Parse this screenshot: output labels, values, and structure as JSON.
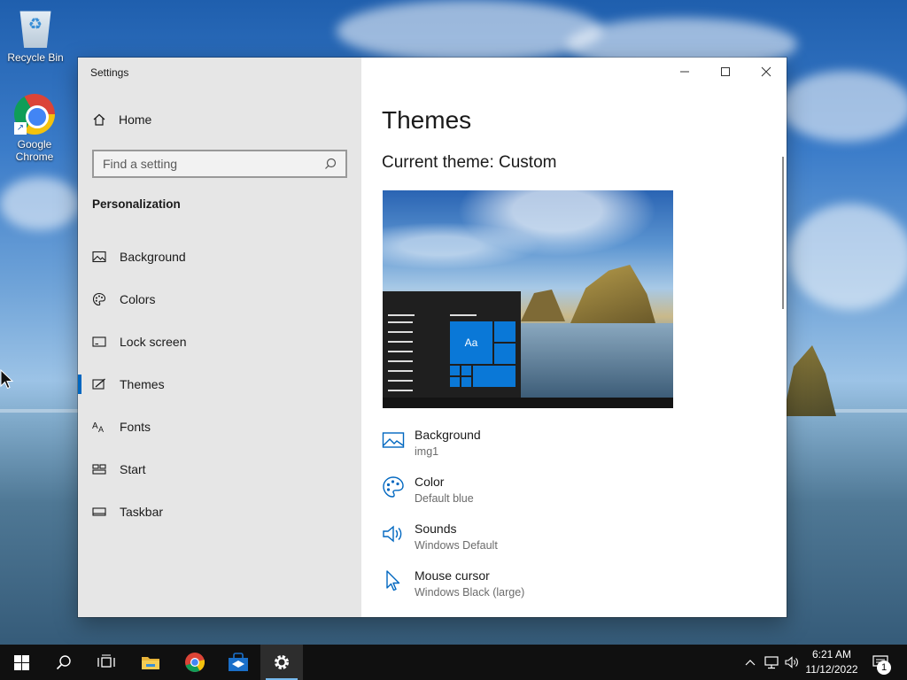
{
  "desktop": {
    "icons": [
      {
        "label": "Recycle Bin",
        "icon": "recycle-bin-icon"
      },
      {
        "label": "Google Chrome",
        "icon": "chrome-icon"
      }
    ]
  },
  "window": {
    "title": "Settings",
    "caption": {
      "minimize": "minimize-icon",
      "maximize": "maximize-icon",
      "close": "close-icon"
    }
  },
  "sidebar": {
    "home_label": "Home",
    "search_placeholder": "Find a setting",
    "section_title": "Personalization",
    "items": [
      {
        "label": "Background",
        "icon": "picture-icon",
        "active": false
      },
      {
        "label": "Colors",
        "icon": "palette-icon",
        "active": false
      },
      {
        "label": "Lock screen",
        "icon": "lock-screen-icon",
        "active": false
      },
      {
        "label": "Themes",
        "icon": "themes-icon",
        "active": true
      },
      {
        "label": "Fonts",
        "icon": "fonts-icon",
        "active": false
      },
      {
        "label": "Start",
        "icon": "start-icon",
        "active": false
      },
      {
        "label": "Taskbar",
        "icon": "taskbar-icon",
        "active": false
      }
    ]
  },
  "main": {
    "title": "Themes",
    "current_theme": "Current theme: Custom",
    "preview_tile_text": "Aa",
    "properties": [
      {
        "name": "Background",
        "value": "img1",
        "icon": "picture-icon"
      },
      {
        "name": "Color",
        "value": "Default blue",
        "icon": "palette-icon"
      },
      {
        "name": "Sounds",
        "value": "Windows Default",
        "icon": "speaker-icon"
      },
      {
        "name": "Mouse cursor",
        "value": "Windows Black (large)",
        "icon": "cursor-icon"
      }
    ]
  },
  "taskbar": {
    "buttons": [
      "start-icon",
      "search-icon",
      "task-view-icon",
      "file-explorer-icon",
      "chrome-icon",
      "store-icon",
      "settings-icon"
    ],
    "clock": {
      "time": "6:21 AM",
      "date": "11/12/2022"
    },
    "notification_count": "1"
  },
  "colors": {
    "accent": "#0067c0",
    "sidebar_bg": "#e6e6e6",
    "taskbar_bg": "#101010"
  }
}
